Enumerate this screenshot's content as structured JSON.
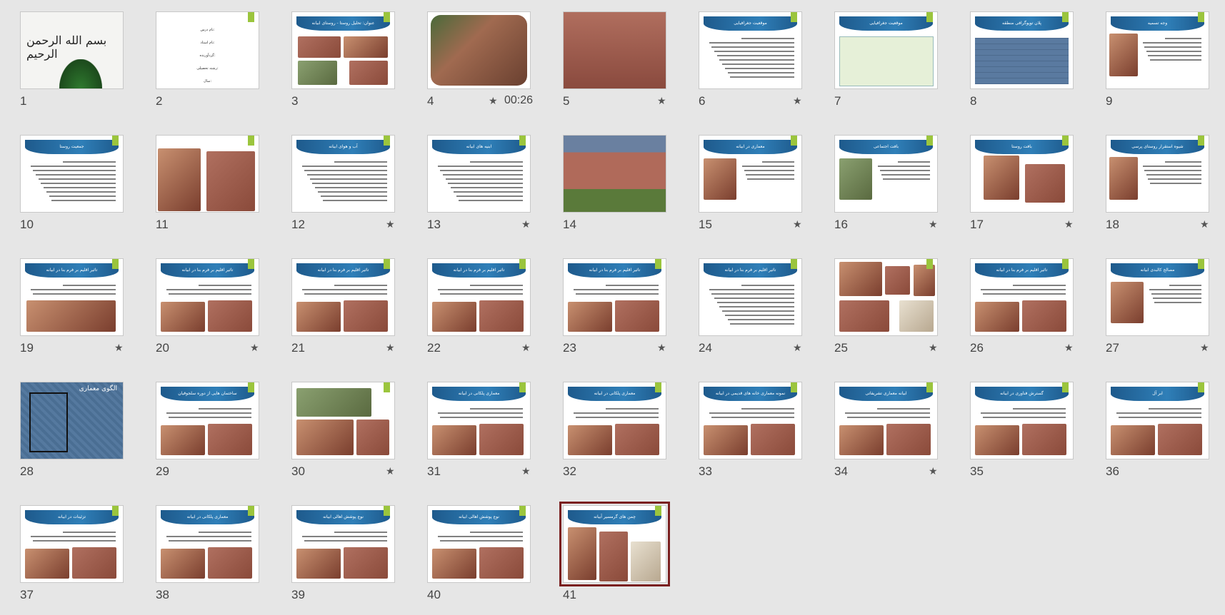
{
  "slides": [
    {
      "n": "1",
      "star": false,
      "time": ""
    },
    {
      "n": "2",
      "star": false,
      "time": ""
    },
    {
      "n": "3",
      "star": false,
      "time": "",
      "title": "عنوان: تحلیل روستا - روستای ابیانه"
    },
    {
      "n": "4",
      "star": true,
      "time": "00:26"
    },
    {
      "n": "5",
      "star": true,
      "time": ""
    },
    {
      "n": "6",
      "star": true,
      "time": "",
      "title": "موقعیت جغرافیایی"
    },
    {
      "n": "7",
      "star": false,
      "time": "",
      "title": "موقعیت جغرافیایی"
    },
    {
      "n": "8",
      "star": false,
      "time": "",
      "title": "پلان توپوگرافی منطقه"
    },
    {
      "n": "9",
      "star": false,
      "time": "",
      "title": "وجه تسمیه"
    },
    {
      "n": "10",
      "star": false,
      "time": "",
      "title": "جمعیت روستا"
    },
    {
      "n": "11",
      "star": false,
      "time": ""
    },
    {
      "n": "12",
      "star": true,
      "time": "",
      "title": "آب و هوای ابیانه"
    },
    {
      "n": "13",
      "star": true,
      "time": "",
      "title": "ابنیه های ابیانه"
    },
    {
      "n": "14",
      "star": false,
      "time": ""
    },
    {
      "n": "15",
      "star": true,
      "time": "",
      "title": "معماری در ابیانه"
    },
    {
      "n": "16",
      "star": true,
      "time": "",
      "title": "بافت اجتماعی"
    },
    {
      "n": "17",
      "star": true,
      "time": "",
      "title": "بافت روستا"
    },
    {
      "n": "18",
      "star": true,
      "time": "",
      "title": "شیوه استقرار روستای پرسی"
    },
    {
      "n": "19",
      "star": true,
      "time": "",
      "title": "تاثیر اقلیم بر فرم بنا در ابیانه"
    },
    {
      "n": "20",
      "star": true,
      "time": "",
      "title": "تاثیر اقلیم بر فرم بنا در ابیانه"
    },
    {
      "n": "21",
      "star": true,
      "time": "",
      "title": "تاثیر اقلیم بر فرم بنا در ابیانه"
    },
    {
      "n": "22",
      "star": true,
      "time": "",
      "title": "تاثیر اقلیم بر فرم بنا در ابیانه"
    },
    {
      "n": "23",
      "star": true,
      "time": "",
      "title": "تاثیر اقلیم بر فرم بنا در ابیانه"
    },
    {
      "n": "24",
      "star": true,
      "time": "",
      "title": "تاثیر اقلیم بر فرم بنا در ابیانه"
    },
    {
      "n": "25",
      "star": true,
      "time": ""
    },
    {
      "n": "26",
      "star": true,
      "time": "",
      "title": "تاثیر اقلیم بر فرم بنا در ابیانه"
    },
    {
      "n": "27",
      "star": true,
      "time": "",
      "title": "مصالح کالبدی ابیانه"
    },
    {
      "n": "28",
      "star": false,
      "time": "",
      "title": "الگوی معماری"
    },
    {
      "n": "29",
      "star": false,
      "time": "",
      "title": "ساختمان هایی از دوره سلجوقیان"
    },
    {
      "n": "30",
      "star": true,
      "time": ""
    },
    {
      "n": "31",
      "star": true,
      "time": "",
      "title": "معماری پلکانی در ابیانه"
    },
    {
      "n": "32",
      "star": false,
      "time": "",
      "title": "معماری پلکانی در ابیانه"
    },
    {
      "n": "33",
      "star": false,
      "time": "",
      "title": "نمونه معماری خانه های قدیمی در ابیانه"
    },
    {
      "n": "34",
      "star": true,
      "time": "",
      "title": "ابیانه معماری تشریفاتی"
    },
    {
      "n": "35",
      "star": false,
      "time": "",
      "title": "گسترش فناوری در ابیانه"
    },
    {
      "n": "36",
      "star": false,
      "time": "",
      "title": "ابر آل"
    },
    {
      "n": "37",
      "star": false,
      "time": "",
      "title": "تزئینات در ابیانه"
    },
    {
      "n": "38",
      "star": false,
      "time": "",
      "title": "معماری پلکانی در ابیانه"
    },
    {
      "n": "39",
      "star": false,
      "time": "",
      "title": "نوع پوشش اهالی ابیانه"
    },
    {
      "n": "40",
      "star": false,
      "time": "",
      "title": "نوع پوشش اهالی ابیانه"
    },
    {
      "n": "41",
      "star": false,
      "time": "",
      "title": "چمن های گرمسیر آبیانه",
      "selected": true
    }
  ],
  "slide2_lines": [
    "نام درس:",
    "نام استاد:",
    "گردآورنده:",
    "رشته تحصیلی:",
    "سال:"
  ],
  "slide28_label": "الگوی معماری",
  "star_glyph": "★",
  "calligraphy": "بسم الله الرحمن الرحیم"
}
